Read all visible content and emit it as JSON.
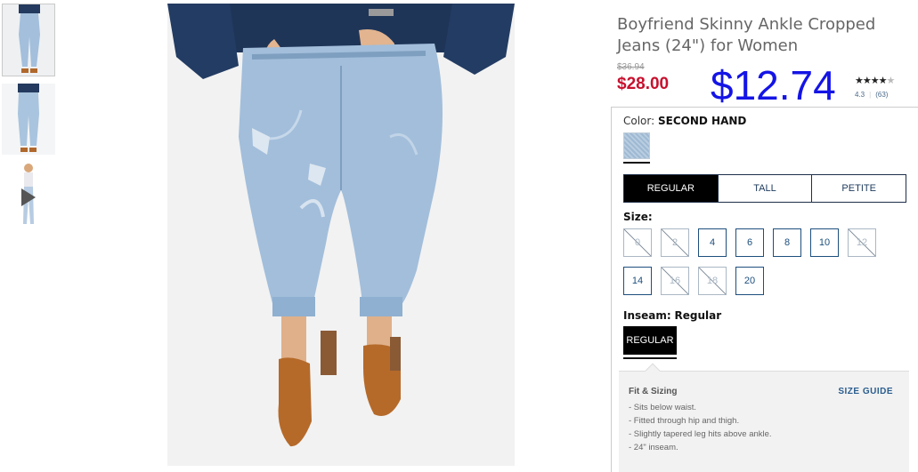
{
  "product": {
    "title": "Boyfriend Skinny Ankle Cropped Jeans (24\") for Women",
    "price_original": "$36.94",
    "price_sale": "$28.00",
    "price_overlay": "$12.74",
    "rating_value": "4.3",
    "review_count": "(63)",
    "rating_stars": 4,
    "stars_max": 5
  },
  "color": {
    "label": "Color:",
    "value": "SECOND HAND",
    "swatch_color": "#a9c2da"
  },
  "fit_tabs": [
    {
      "label": "REGULAR",
      "selected": true
    },
    {
      "label": "TALL",
      "selected": false
    },
    {
      "label": "PETITE",
      "selected": false
    }
  ],
  "size": {
    "label": "Size:",
    "options": [
      {
        "value": "0",
        "available": false
      },
      {
        "value": "2",
        "available": false
      },
      {
        "value": "4",
        "available": true
      },
      {
        "value": "6",
        "available": true
      },
      {
        "value": "8",
        "available": true
      },
      {
        "value": "10",
        "available": true
      },
      {
        "value": "12",
        "available": false
      },
      {
        "value": "14",
        "available": true
      },
      {
        "value": "16",
        "available": false
      },
      {
        "value": "18",
        "available": false
      },
      {
        "value": "20",
        "available": true
      }
    ]
  },
  "inseam": {
    "label": "Inseam:",
    "value": "Regular",
    "button": "REGULAR"
  },
  "fit_sizing": {
    "heading": "Fit & Sizing",
    "guide_link": "SIZE GUIDE",
    "bullets": [
      "- Sits below waist.",
      "- Fitted through hip and thigh.",
      "- Slightly tapered leg hits above ankle.",
      "- 24\" inseam."
    ]
  },
  "colors": {
    "sale_red": "#c8102e",
    "overlay_blue": "#1414e6",
    "link_blue": "#2a5d8f"
  }
}
